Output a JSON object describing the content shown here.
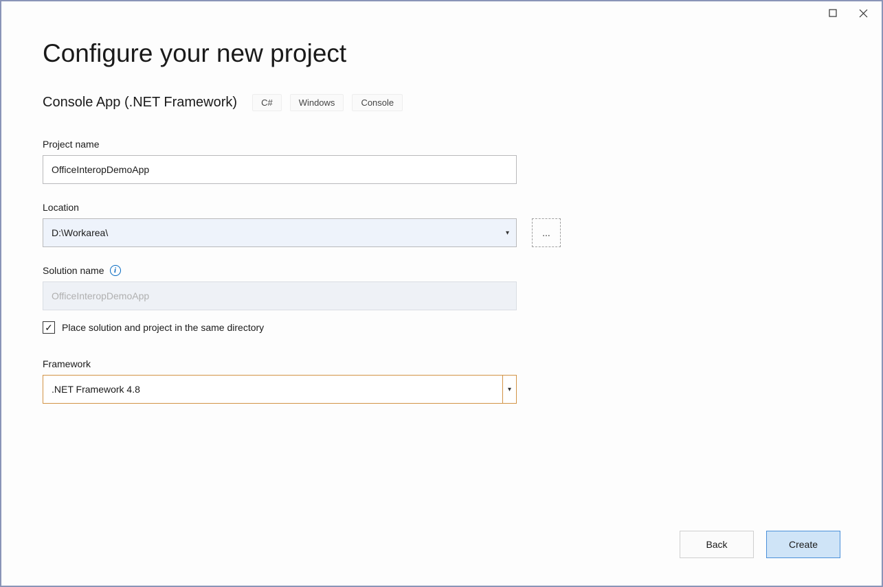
{
  "titlebar": {
    "restore_icon": "restore",
    "close_icon": "close"
  },
  "header": {
    "title": "Configure your new project",
    "template_name": "Console App (.NET Framework)",
    "tags": [
      "C#",
      "Windows",
      "Console"
    ]
  },
  "fields": {
    "project_name": {
      "label": "Project name",
      "value": "OfficeInteropDemoApp"
    },
    "location": {
      "label": "Location",
      "value": "D:\\Workarea\\",
      "browse": "..."
    },
    "solution_name": {
      "label": "Solution name",
      "placeholder": "OfficeInteropDemoApp",
      "info": "i"
    },
    "same_directory": {
      "checked": true,
      "label": "Place solution and project in the same directory"
    },
    "framework": {
      "label": "Framework",
      "value": ".NET Framework 4.8"
    }
  },
  "footer": {
    "back": "Back",
    "create": "Create"
  },
  "icons": {
    "checkmark": "✓",
    "dropdown": "▾"
  }
}
